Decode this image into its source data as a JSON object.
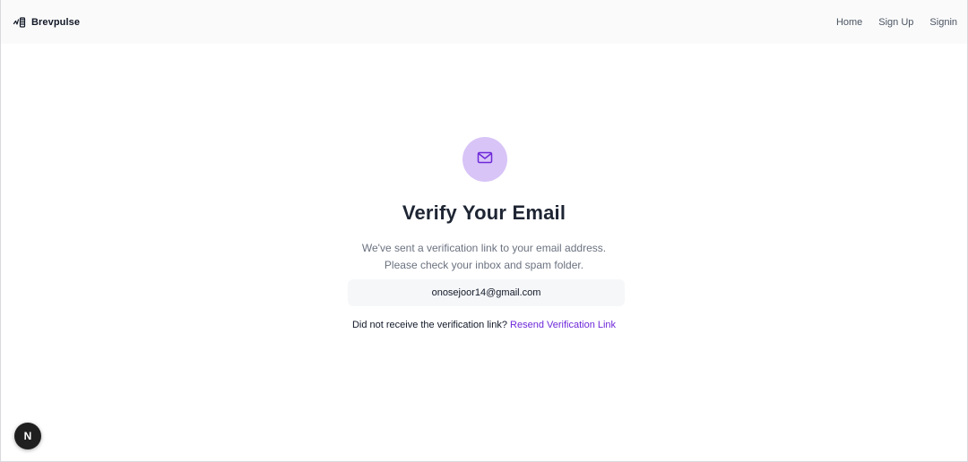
{
  "navbar": {
    "brand_name": "Brevpulse",
    "links": [
      "Home",
      "Sign Up",
      "Signin"
    ]
  },
  "main": {
    "icon": "mail-icon",
    "title": "Verify Your Email",
    "description_line1": "We've sent a verification link to your email address.",
    "description_line2": "Please check your inbox and spam folder.",
    "email": "onosejoor14@gmail.com",
    "resend_prompt": "Did not receive the verification link?",
    "resend_link": "Resend Verification Link"
  },
  "badge": {
    "letter": "N"
  },
  "colors": {
    "accent": "#6d28d9",
    "icon_circle": "#d8c4f7",
    "navbar_bg": "#fafafa"
  }
}
